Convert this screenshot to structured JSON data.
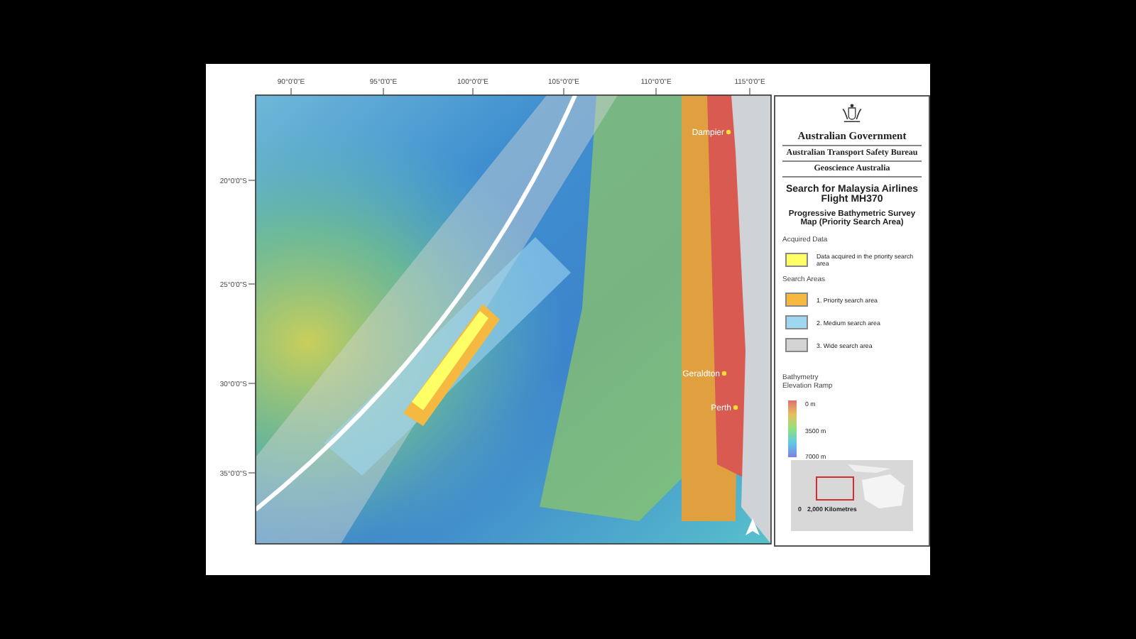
{
  "map": {
    "longitude_ticks": [
      "90°0'0\"E",
      "95°0'0\"E",
      "100°0'0\"E",
      "105°0'0\"E",
      "110°0'0\"E",
      "115°0'0\"E"
    ],
    "latitude_ticks": [
      "20°0'0\"S",
      "25°0'0\"S",
      "30°0'0\"S",
      "35°0'0\"S"
    ],
    "places": [
      {
        "name": "Dampier"
      },
      {
        "name": "Geraldton"
      },
      {
        "name": "Perth"
      }
    ]
  },
  "header": {
    "government": "Australian Government",
    "bureau": "Australian Transport Safety Bureau",
    "agency": "Geoscience Australia"
  },
  "title": "Search for Malaysia Airlines Flight MH370",
  "subtitle": "Progressive Bathymetric Survey Map (Priority Search Area)",
  "legend": [
    {
      "heading": "Acquired Data",
      "items": [
        {
          "label": "Data acquired in the priority search area",
          "color": "#ffff66"
        }
      ]
    },
    {
      "heading": "Search Areas",
      "items": [
        {
          "label": "1. Priority search area",
          "color": "#f5b942"
        },
        {
          "label": "2. Medium search area",
          "color": "#9fd6f0"
        },
        {
          "label": "3. Wide search area",
          "color": "#d4d4d4"
        }
      ]
    }
  ],
  "elevation_ramp": {
    "title": "Bathymetry Elevation Ramp",
    "labels": [
      "0 m",
      "3500 m",
      "7000 m"
    ]
  },
  "inset": {
    "scale_labels": [
      "0",
      "2,000 Kilometres"
    ]
  }
}
